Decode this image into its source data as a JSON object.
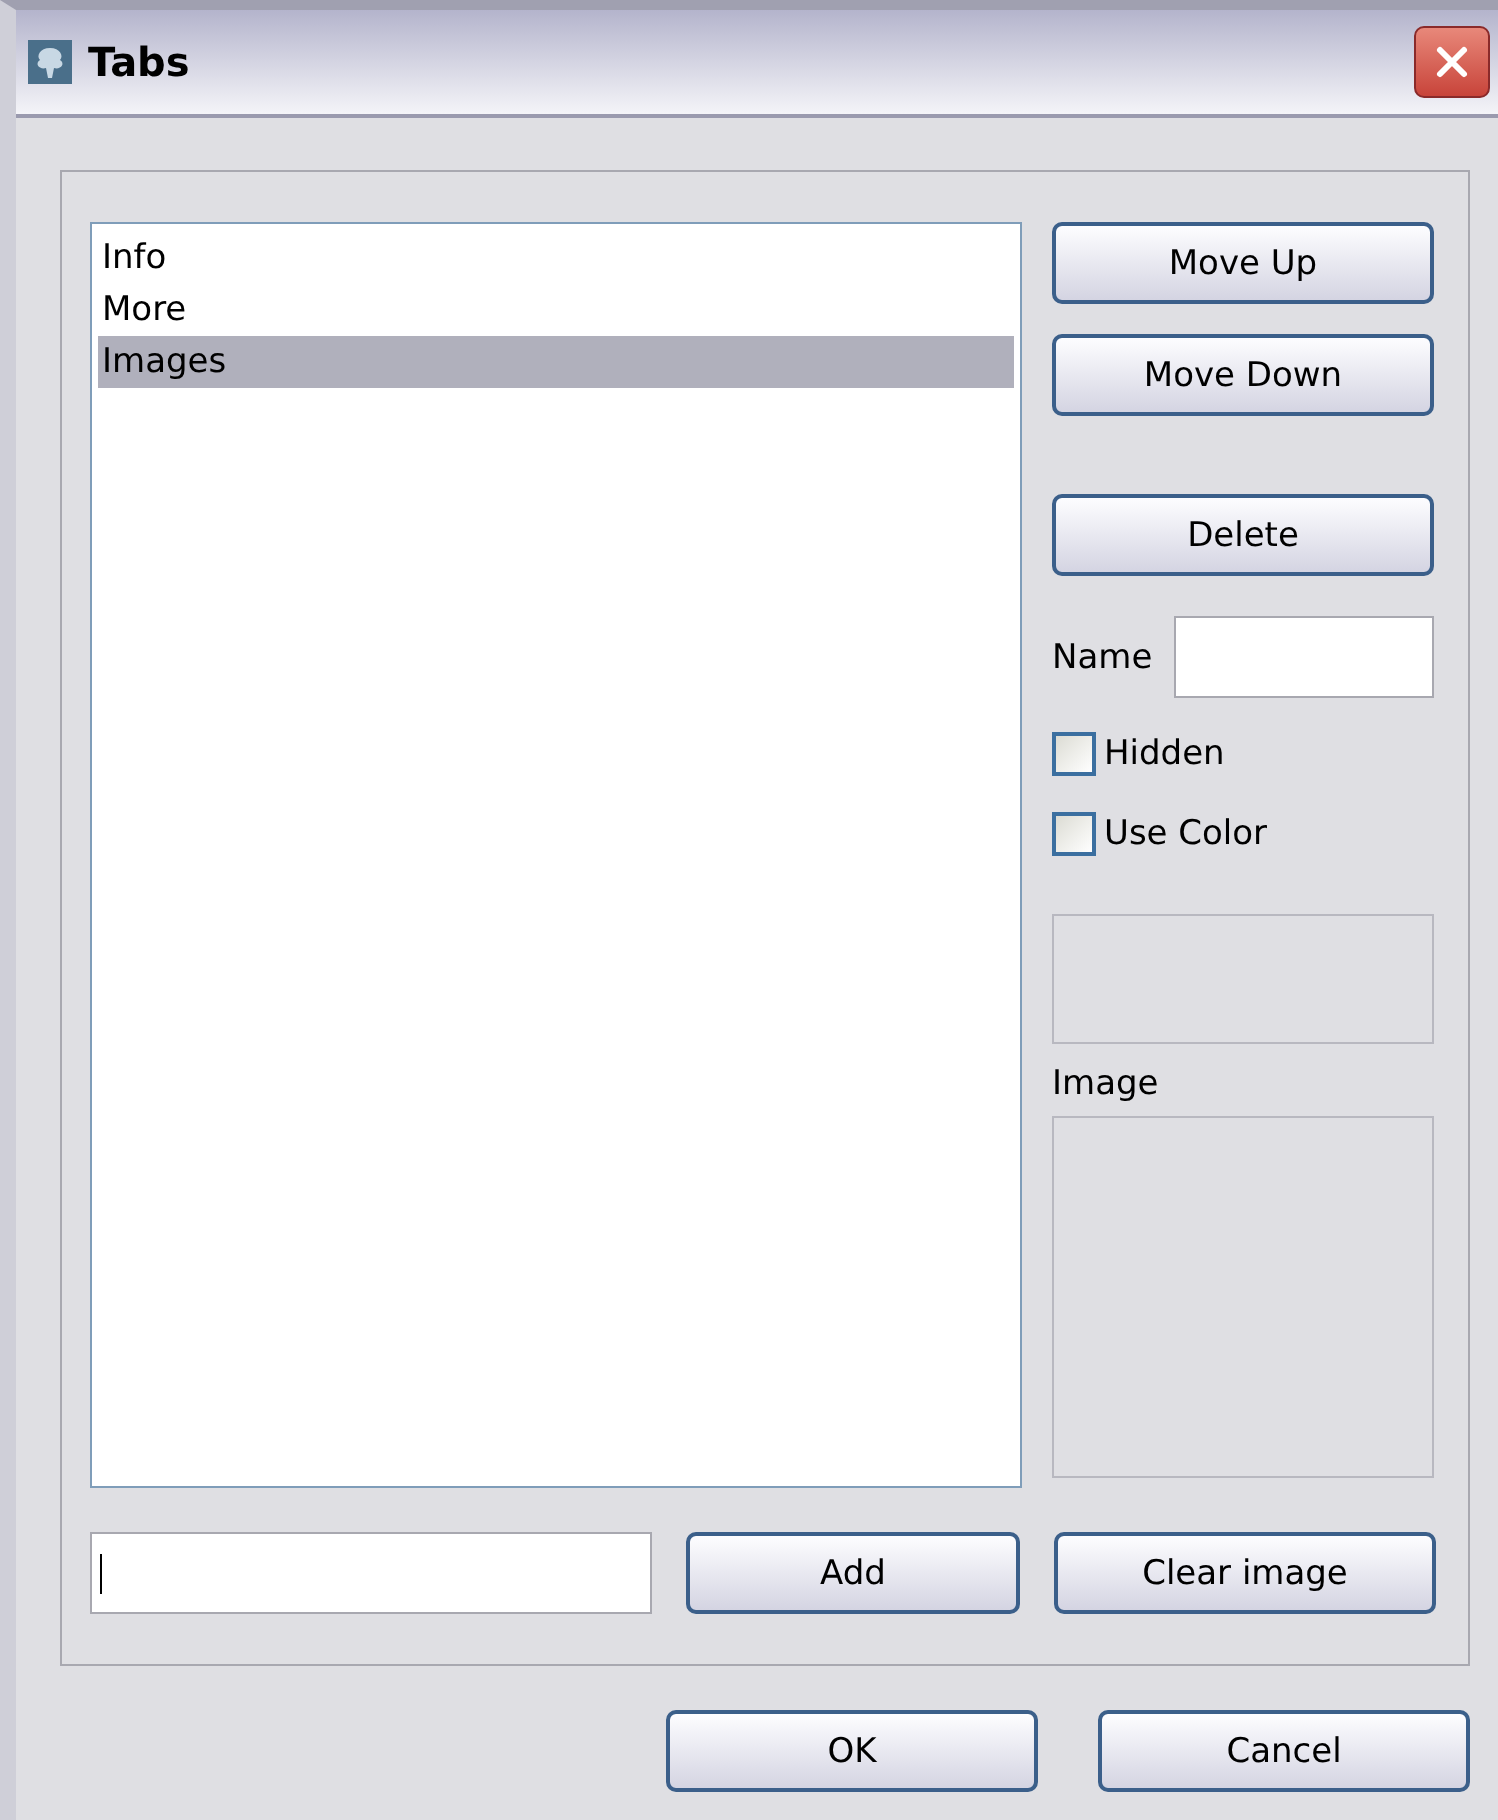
{
  "window": {
    "title": "Tabs"
  },
  "tab_list": {
    "items": [
      {
        "label": "Info",
        "selected": false
      },
      {
        "label": "More",
        "selected": false
      },
      {
        "label": "Images",
        "selected": true
      }
    ]
  },
  "side_buttons": [
    "Move Up",
    "Move Down",
    "Delete"
  ],
  "name_field": {
    "label": "Name"
  },
  "checkboxes": [
    {
      "label": "Hidden",
      "checked": false
    },
    {
      "label": "Use Color",
      "checked": false
    }
  ],
  "image_label": "Image",
  "add_button": "Add",
  "clear_image_button": "Clear image",
  "footer_buttons": [
    "OK",
    "Cancel"
  ]
}
